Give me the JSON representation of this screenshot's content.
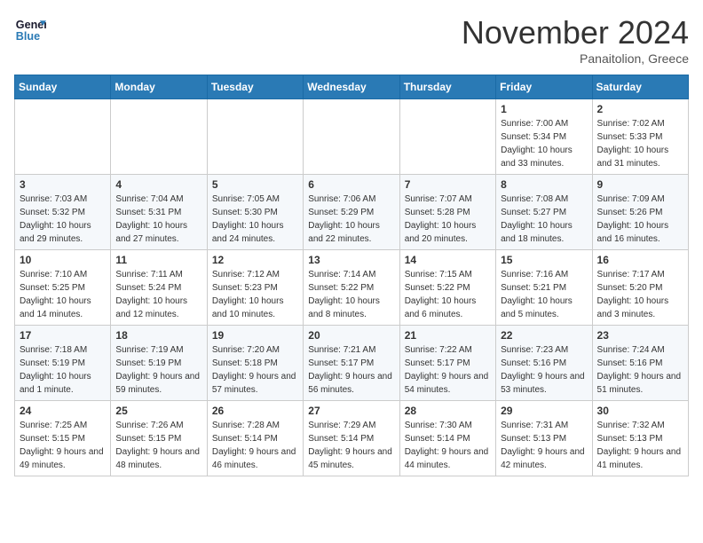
{
  "header": {
    "logo_line1": "General",
    "logo_line2": "Blue",
    "month": "November 2024",
    "location": "Panaitolion, Greece"
  },
  "weekdays": [
    "Sunday",
    "Monday",
    "Tuesday",
    "Wednesday",
    "Thursday",
    "Friday",
    "Saturday"
  ],
  "weeks": [
    [
      null,
      null,
      null,
      null,
      null,
      {
        "day": 1,
        "sunrise": "7:00 AM",
        "sunset": "5:34 PM",
        "daylight": "10 hours and 33 minutes."
      },
      {
        "day": 2,
        "sunrise": "7:02 AM",
        "sunset": "5:33 PM",
        "daylight": "10 hours and 31 minutes."
      }
    ],
    [
      {
        "day": 3,
        "sunrise": "7:03 AM",
        "sunset": "5:32 PM",
        "daylight": "10 hours and 29 minutes."
      },
      {
        "day": 4,
        "sunrise": "7:04 AM",
        "sunset": "5:31 PM",
        "daylight": "10 hours and 27 minutes."
      },
      {
        "day": 5,
        "sunrise": "7:05 AM",
        "sunset": "5:30 PM",
        "daylight": "10 hours and 24 minutes."
      },
      {
        "day": 6,
        "sunrise": "7:06 AM",
        "sunset": "5:29 PM",
        "daylight": "10 hours and 22 minutes."
      },
      {
        "day": 7,
        "sunrise": "7:07 AM",
        "sunset": "5:28 PM",
        "daylight": "10 hours and 20 minutes."
      },
      {
        "day": 8,
        "sunrise": "7:08 AM",
        "sunset": "5:27 PM",
        "daylight": "10 hours and 18 minutes."
      },
      {
        "day": 9,
        "sunrise": "7:09 AM",
        "sunset": "5:26 PM",
        "daylight": "10 hours and 16 minutes."
      }
    ],
    [
      {
        "day": 10,
        "sunrise": "7:10 AM",
        "sunset": "5:25 PM",
        "daylight": "10 hours and 14 minutes."
      },
      {
        "day": 11,
        "sunrise": "7:11 AM",
        "sunset": "5:24 PM",
        "daylight": "10 hours and 12 minutes."
      },
      {
        "day": 12,
        "sunrise": "7:12 AM",
        "sunset": "5:23 PM",
        "daylight": "10 hours and 10 minutes."
      },
      {
        "day": 13,
        "sunrise": "7:14 AM",
        "sunset": "5:22 PM",
        "daylight": "10 hours and 8 minutes."
      },
      {
        "day": 14,
        "sunrise": "7:15 AM",
        "sunset": "5:22 PM",
        "daylight": "10 hours and 6 minutes."
      },
      {
        "day": 15,
        "sunrise": "7:16 AM",
        "sunset": "5:21 PM",
        "daylight": "10 hours and 5 minutes."
      },
      {
        "day": 16,
        "sunrise": "7:17 AM",
        "sunset": "5:20 PM",
        "daylight": "10 hours and 3 minutes."
      }
    ],
    [
      {
        "day": 17,
        "sunrise": "7:18 AM",
        "sunset": "5:19 PM",
        "daylight": "10 hours and 1 minute."
      },
      {
        "day": 18,
        "sunrise": "7:19 AM",
        "sunset": "5:19 PM",
        "daylight": "9 hours and 59 minutes."
      },
      {
        "day": 19,
        "sunrise": "7:20 AM",
        "sunset": "5:18 PM",
        "daylight": "9 hours and 57 minutes."
      },
      {
        "day": 20,
        "sunrise": "7:21 AM",
        "sunset": "5:17 PM",
        "daylight": "9 hours and 56 minutes."
      },
      {
        "day": 21,
        "sunrise": "7:22 AM",
        "sunset": "5:17 PM",
        "daylight": "9 hours and 54 minutes."
      },
      {
        "day": 22,
        "sunrise": "7:23 AM",
        "sunset": "5:16 PM",
        "daylight": "9 hours and 53 minutes."
      },
      {
        "day": 23,
        "sunrise": "7:24 AM",
        "sunset": "5:16 PM",
        "daylight": "9 hours and 51 minutes."
      }
    ],
    [
      {
        "day": 24,
        "sunrise": "7:25 AM",
        "sunset": "5:15 PM",
        "daylight": "9 hours and 49 minutes."
      },
      {
        "day": 25,
        "sunrise": "7:26 AM",
        "sunset": "5:15 PM",
        "daylight": "9 hours and 48 minutes."
      },
      {
        "day": 26,
        "sunrise": "7:28 AM",
        "sunset": "5:14 PM",
        "daylight": "9 hours and 46 minutes."
      },
      {
        "day": 27,
        "sunrise": "7:29 AM",
        "sunset": "5:14 PM",
        "daylight": "9 hours and 45 minutes."
      },
      {
        "day": 28,
        "sunrise": "7:30 AM",
        "sunset": "5:14 PM",
        "daylight": "9 hours and 44 minutes."
      },
      {
        "day": 29,
        "sunrise": "7:31 AM",
        "sunset": "5:13 PM",
        "daylight": "9 hours and 42 minutes."
      },
      {
        "day": 30,
        "sunrise": "7:32 AM",
        "sunset": "5:13 PM",
        "daylight": "9 hours and 41 minutes."
      }
    ]
  ]
}
